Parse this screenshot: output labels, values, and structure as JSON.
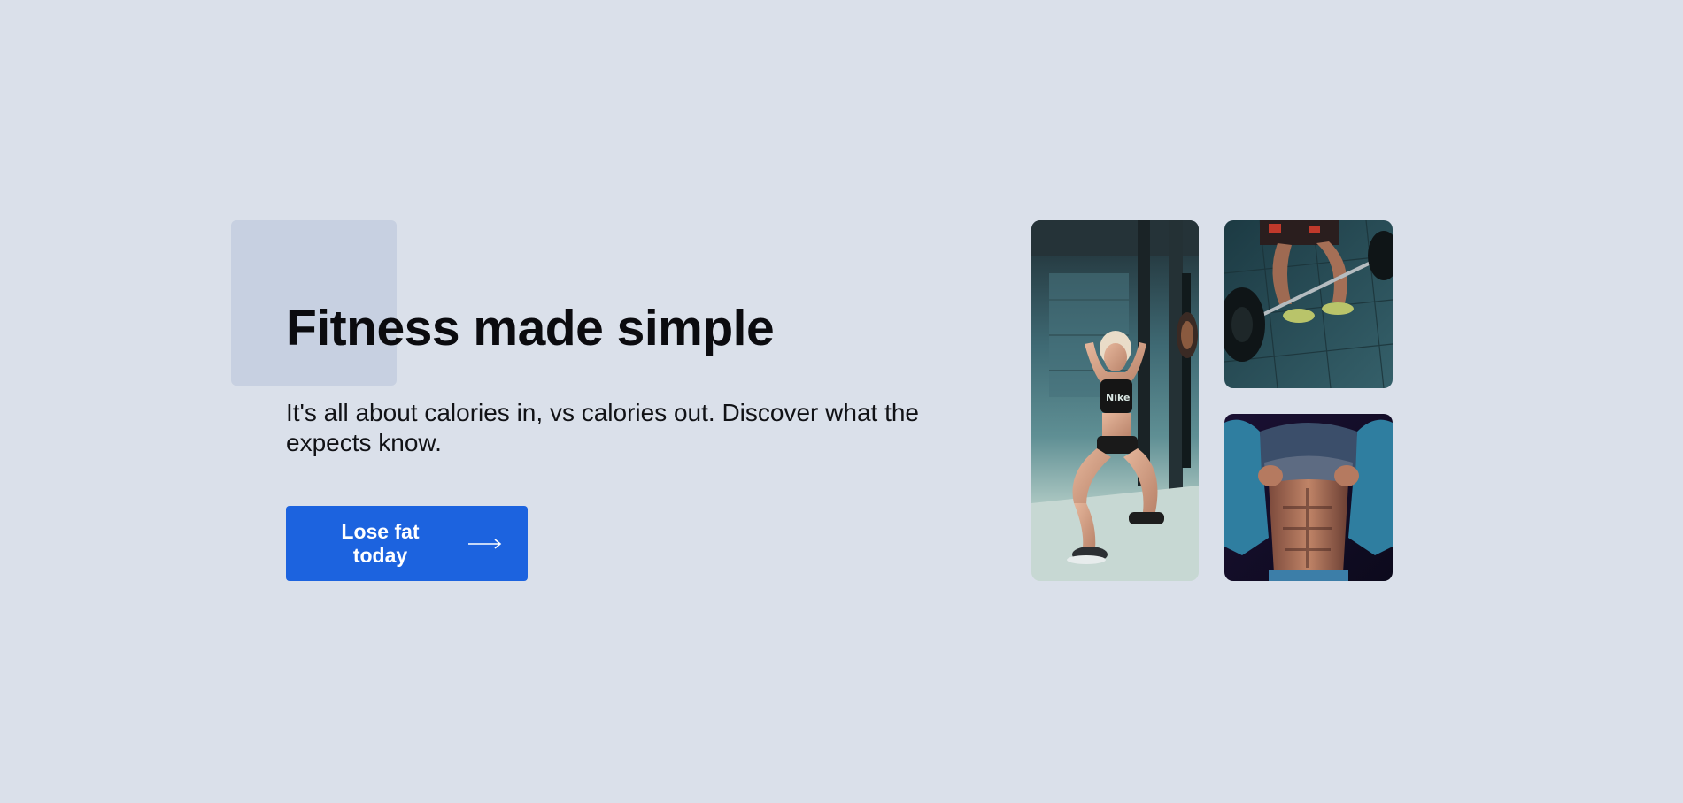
{
  "hero": {
    "headline": "Fitness made simple",
    "subtext": "It's all about calories in, vs calories out. Discover what the expects know.",
    "cta": {
      "label": "Lose fat today",
      "icon": "arrow-right-icon"
    }
  },
  "gallery": {
    "images": [
      {
        "name": "woman-situps-photo"
      },
      {
        "name": "barbell-deadlift-photo"
      },
      {
        "name": "abs-shirt-lift-photo"
      }
    ]
  },
  "colors": {
    "background": "#dae0ea",
    "accent_square": "#c7d0e1",
    "button": "#1c63df",
    "button_text": "#ffffff",
    "text": "#0b0b0f"
  }
}
